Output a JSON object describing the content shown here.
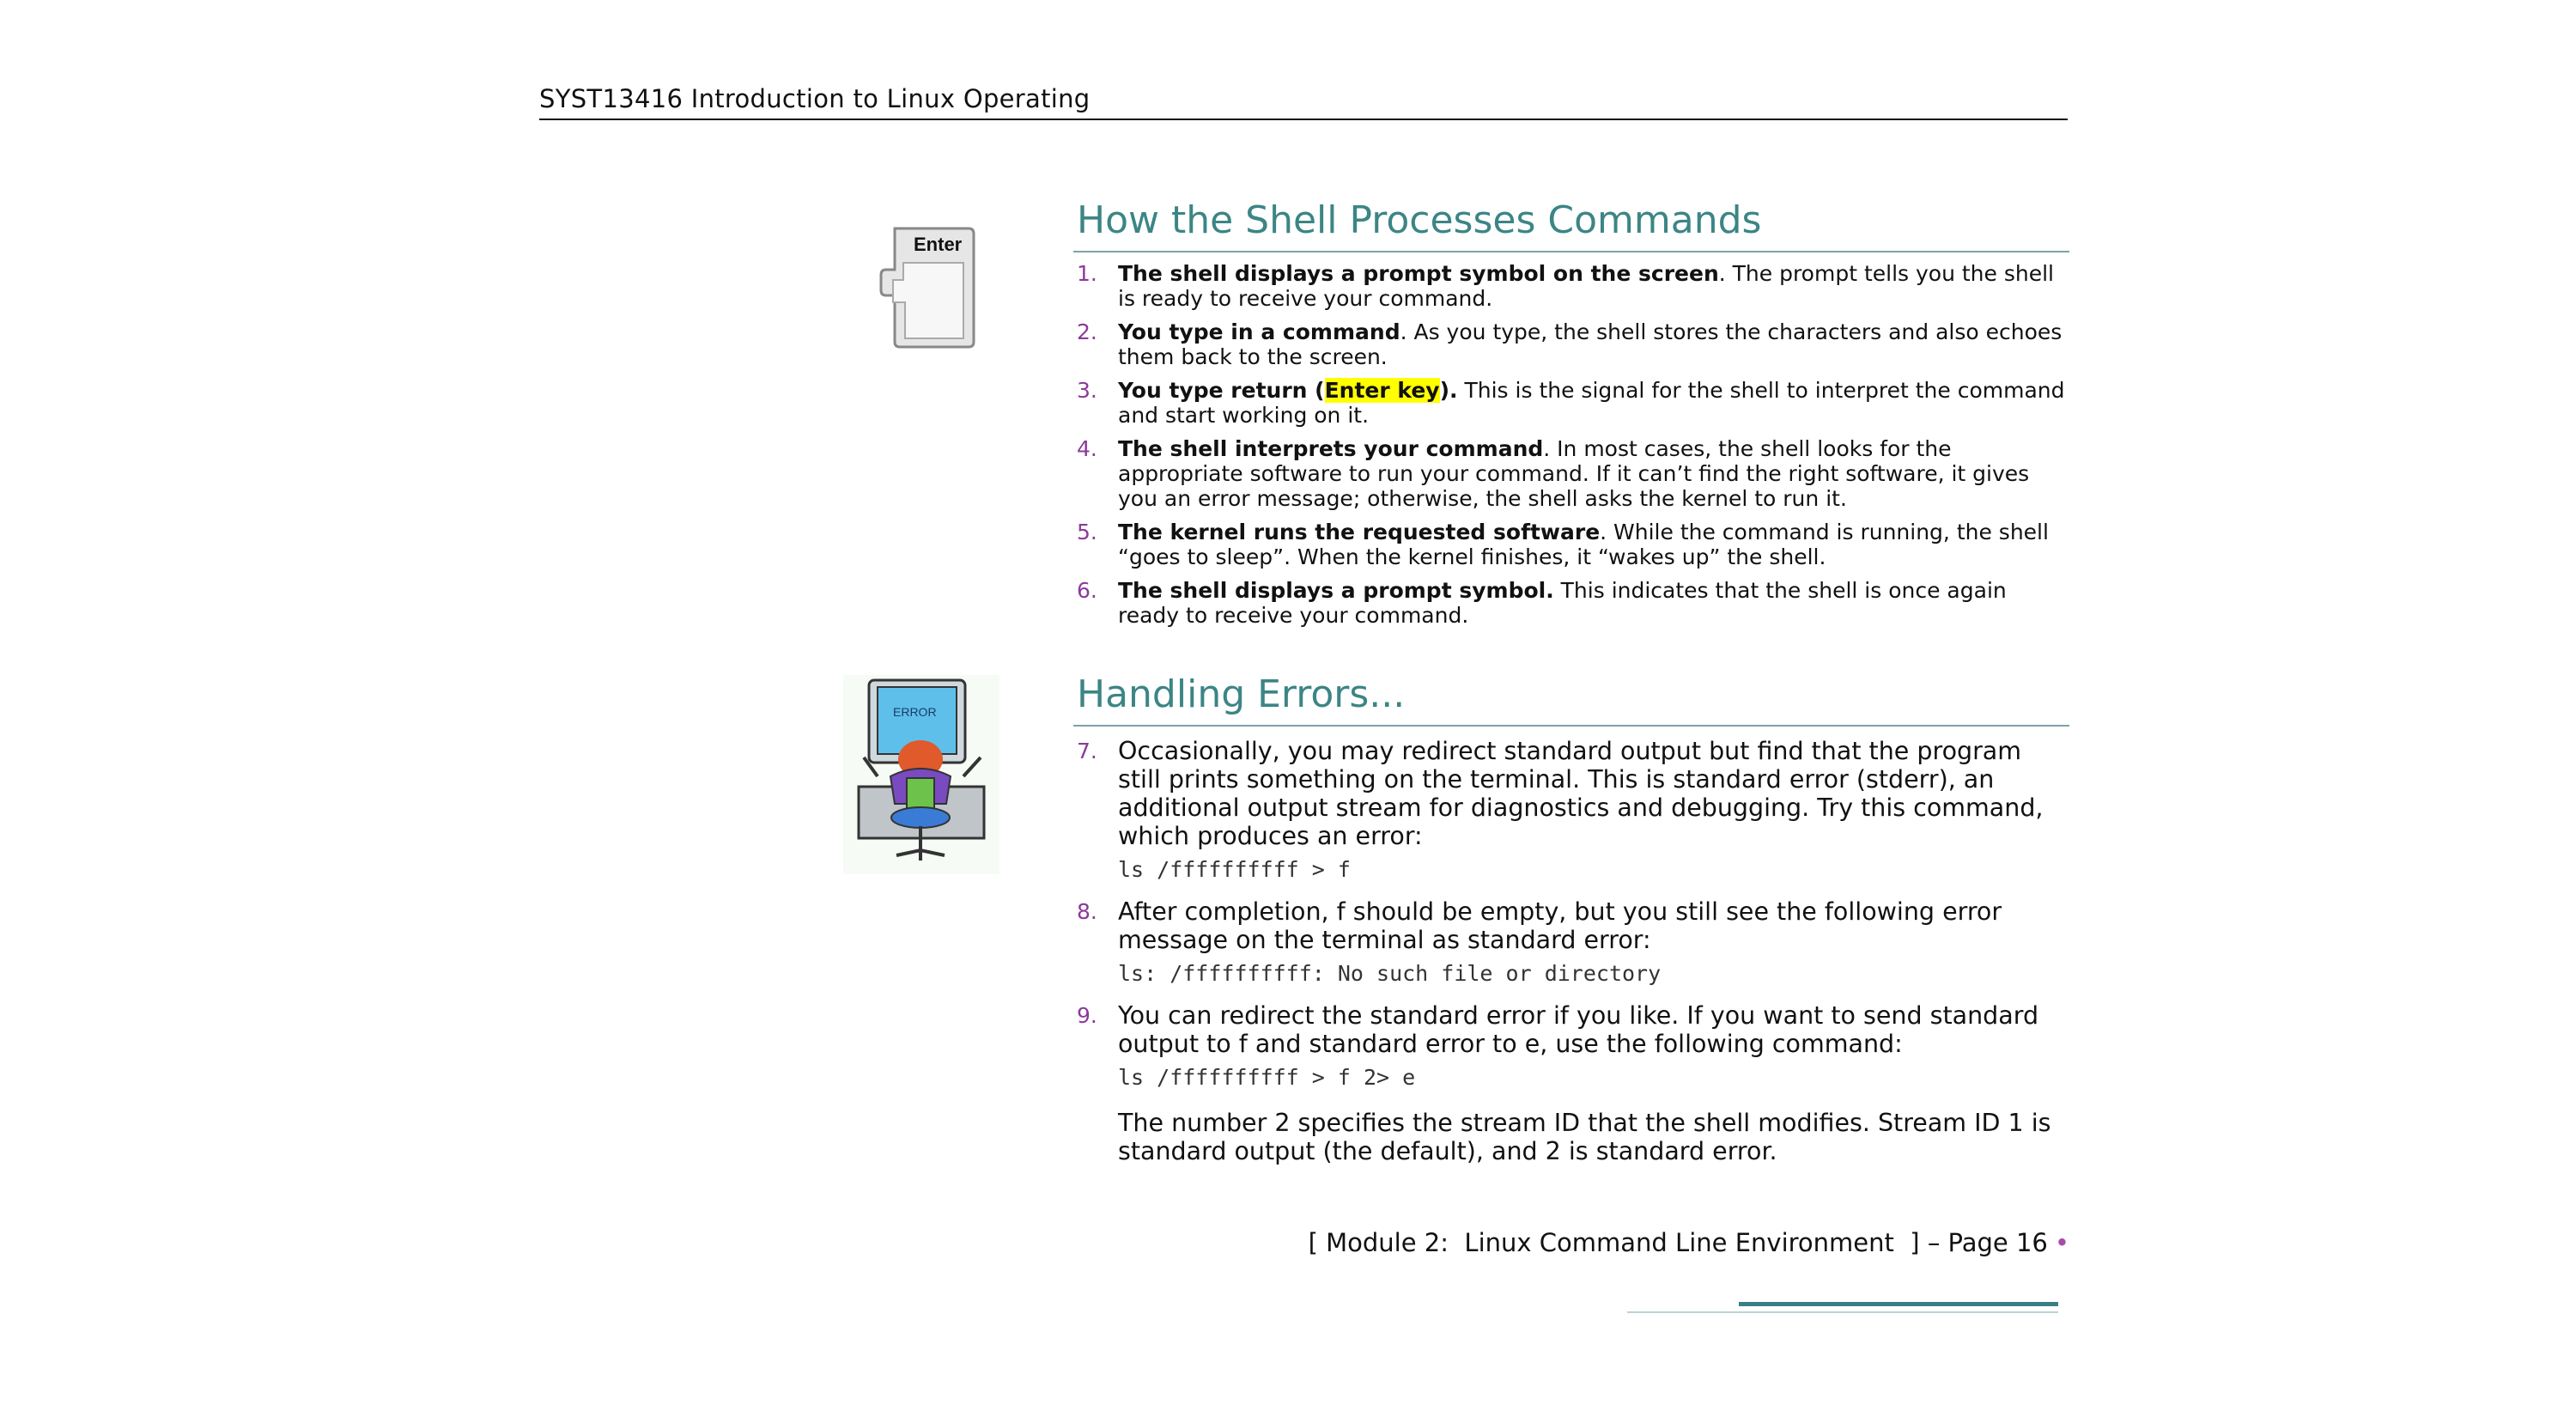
{
  "header": {
    "course": "SYST13416 Introduction to Linux Operating"
  },
  "icons": {
    "key_label": "Enter",
    "error_screen_label": "ERROR"
  },
  "section1": {
    "title": "How the Shell Processes Commands",
    "items": [
      {
        "num": "1.",
        "bold": "The shell displays a prompt symbol on the screen",
        "text": ". The prompt tells you the shell is ready to receive your command."
      },
      {
        "num": "2.",
        "bold": "You type in a command",
        "text": ". As you type, the shell stores the characters and also echoes them back to the screen."
      },
      {
        "num": "3.",
        "bold_pre": "You type return (",
        "highlight": "Enter key",
        "bold_post": ").",
        "text": " This is the signal for the shell to interpret the command and start working on it."
      },
      {
        "num": "4.",
        "bold": "The shell interprets your command",
        "text": ". In most cases, the shell looks for the appropriate software to run your command. If it can’t find the right software, it gives you an error message; otherwise, the shell asks the kernel to run it."
      },
      {
        "num": "5.",
        "bold": "The kernel runs the requested software",
        "text": ". While the command is running, the shell “goes to sleep”. When the kernel finishes, it “wakes up” the shell."
      },
      {
        "num": "6.",
        "bold": "The shell displays a prompt symbol.",
        "text": " This indicates that the shell is once again ready to receive your command."
      }
    ]
  },
  "section2": {
    "title": "Handling Errors...",
    "items": [
      {
        "num": "7.",
        "text": "Occasionally, you may redirect standard output but find that the program still prints something on the terminal. This is standard error (stderr), an additional output stream for diagnostics and debugging. Try this command, which produces an error:",
        "code": "ls /ffffffffff > f"
      },
      {
        "num": "8.",
        "text": "After completion, f should be empty, but you still see the following error message on the terminal as standard error:",
        "code": "ls: /ffffffffff: No such file or directory"
      },
      {
        "num": "9.",
        "text": "You can redirect the standard error if you like. If you want to send standard output to f and standard error to e, use the following command:",
        "code": "ls /ffffffffff > f 2> e"
      }
    ],
    "note": "The number 2 specifies the stream ID that the shell modifies. Stream ID 1 is standard output (the default), and 2 is standard error."
  },
  "footer": {
    "text": "[ Module 2:  Linux Command Line Environment  ] – Page 16",
    "dot": "•"
  },
  "colors": {
    "heading": "#3c8585",
    "number": "#8b3a9a",
    "highlight": "#ffff00",
    "rule": "#3a7f86"
  }
}
